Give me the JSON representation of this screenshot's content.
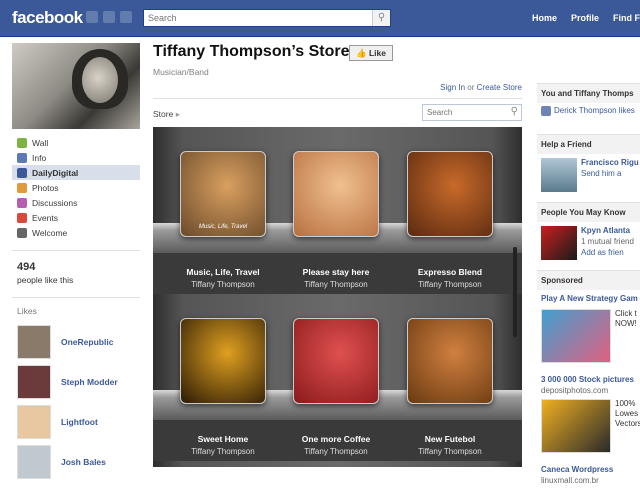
{
  "header": {
    "logo": "facebook",
    "search_placeholder": "Search",
    "nav": [
      "Home",
      "Profile",
      "Find F"
    ]
  },
  "sidebar": {
    "items": [
      {
        "label": "Wall",
        "icon": "wall-icon",
        "color": "#7cb342"
      },
      {
        "label": "Info",
        "icon": "info-icon",
        "color": "#5c7ab8"
      },
      {
        "label": "DailyDigital",
        "icon": "dailydigital-icon",
        "color": "#3b5998",
        "active": true
      },
      {
        "label": "Photos",
        "icon": "photos-icon",
        "color": "#e09c3c"
      },
      {
        "label": "Discussions",
        "icon": "discussions-icon",
        "color": "#b65fb0"
      },
      {
        "label": "Events",
        "icon": "calendar-icon",
        "color": "#d94a3a"
      },
      {
        "label": "Welcome",
        "icon": "star-icon",
        "color": "#666666"
      }
    ],
    "fan_count": "494",
    "fan_label": "people like this",
    "likes_heading": "Likes",
    "likes": [
      {
        "name": "OneRepublic",
        "color": "#8a7a6a"
      },
      {
        "name": "Steph Modder",
        "color": "#6b3a3a"
      },
      {
        "name": "Lightfoot",
        "color": "#e8c8a0"
      },
      {
        "name": "Josh Bales",
        "color": "#c0c8d0"
      }
    ]
  },
  "main": {
    "title": "Tiffany Thompson’s Store",
    "like_label": "Like",
    "category": "Musician/Band",
    "sign_in": "Sign In",
    "or": "or",
    "create_store": "Create Store",
    "crumb": "Store",
    "store_search_placeholder": "Search"
  },
  "albums": [
    {
      "title": "Music, Life, Travel",
      "artist": "Tiffany Thompson",
      "cover_text": "Music, Life, Travel",
      "color1": "#6b4a2a",
      "color2": "#d9a060"
    },
    {
      "title": "Please stay here",
      "artist": "Tiffany Thompson",
      "color1": "#b87040",
      "color2": "#f0c090"
    },
    {
      "title": "Expresso Blend",
      "artist": "Tiffany Thompson",
      "color1": "#5a2a10",
      "color2": "#c86a2a"
    },
    {
      "title": "Sweet Home",
      "artist": "Tiffany Thompson",
      "color1": "#2a1a05",
      "color2": "#e0a020"
    },
    {
      "title": "One more Coffee",
      "artist": "Tiffany Thompson",
      "color1": "#8a1a1a",
      "color2": "#e05050"
    },
    {
      "title": "New Futebol",
      "artist": "Tiffany Thompson",
      "color1": "#6a3a10",
      "color2": "#d08040"
    }
  ],
  "right": {
    "you_and": "You and Tiffany Thomps",
    "friend_like": "Derick Thompson likes",
    "help_heading": "Help a Friend",
    "help_name": "Francisco Rigu",
    "help_action": "Send him a",
    "pymk_heading": "People You May Know",
    "pymk_name": "Kpyn Atlanta",
    "pymk_mutual": "1 mutual friend",
    "pymk_add": "Add as frien",
    "sponsored_heading": "Sponsored",
    "ads": [
      {
        "title": "Play A New Strategy Gam",
        "sub": "",
        "body": "Click t NOW!",
        "color1": "#40a0d0",
        "color2": "#e06080"
      },
      {
        "title": "3 000 000 Stock pictures",
        "sub": "depositphotos.com",
        "body": "100% Lowes Vectors",
        "color1": "#f0b020",
        "color2": "#2a2a2a"
      },
      {
        "title": "Caneca Wordpress",
        "sub": "linuxmall.com.br",
        "body": "",
        "color1": "#ffffff",
        "color2": "#ffffff"
      }
    ]
  }
}
